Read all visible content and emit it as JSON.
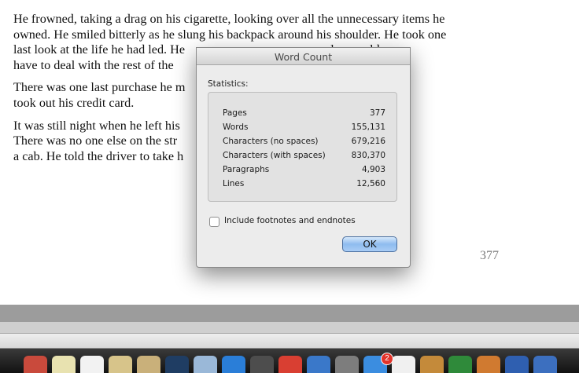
{
  "document": {
    "paragraphs": [
      [
        "He frowned, taking a drag on his cigarette, looking over all the unnecessary items he",
        "owned. He smiled bitterly as he slung his backpack around his shoulder. He took one",
        "last look at the life he had led. He                                            else would",
        "have to deal with the rest of the "
      ],
      [
        "There was one last purchase he m                                             sive laptop and",
        "took out his credit card."
      ],
      [
        "It was still night when he left his                                            few hours.",
        "There was no one else on the str                                             until he found",
        "a cab. He told the driver to take h"
      ]
    ],
    "page_number": "377"
  },
  "dialog": {
    "title": "Word Count",
    "statistics_label": "Statistics:",
    "stats": [
      {
        "label": "Pages",
        "value": "377"
      },
      {
        "label": "Words",
        "value": "155,131"
      },
      {
        "label": "Characters (no spaces)",
        "value": "679,216"
      },
      {
        "label": "Characters (with spaces)",
        "value": "830,370"
      },
      {
        "label": "Paragraphs",
        "value": "4,903"
      },
      {
        "label": "Lines",
        "value": "12,560"
      }
    ],
    "footnotes_checkbox_label": "Include footnotes and endnotes",
    "footnotes_checked": false,
    "ok_label": "OK"
  },
  "dock": {
    "badge_count": "2",
    "items": [
      {
        "icon": "calendar-icon",
        "color": "#c94a3c"
      },
      {
        "icon": "notes-icon",
        "color": "#e8e2b0"
      },
      {
        "icon": "reminders-icon",
        "color": "#f2f2f2"
      },
      {
        "icon": "stickies-icon",
        "color": "#d7c48a"
      },
      {
        "icon": "finder-icon",
        "color": "#c9b07a"
      },
      {
        "icon": "quicktime-icon",
        "color": "#1f3d63"
      },
      {
        "icon": "preview-icon",
        "color": "#9ab8d8"
      },
      {
        "icon": "xcode-icon",
        "color": "#2a7ed8"
      },
      {
        "icon": "mail-icon",
        "color": "#4d4d4d"
      },
      {
        "icon": "chrome-icon",
        "color": "#d93f32"
      },
      {
        "icon": "screen-sharing-icon",
        "color": "#3a78c9"
      },
      {
        "icon": "system-preferences-icon",
        "color": "#7d7d7d"
      },
      {
        "icon": "app-store-icon",
        "color": "#3b8de0"
      },
      {
        "icon": "textedit-icon",
        "color": "#f0f0f0"
      },
      {
        "icon": "script-editor-icon",
        "color": "#c48a3a"
      },
      {
        "icon": "excel-icon",
        "color": "#2f8a3a"
      },
      {
        "icon": "powerpoint-icon",
        "color": "#d07a30"
      },
      {
        "icon": "word-icon",
        "color": "#2f5fb0"
      },
      {
        "icon": "more-icon",
        "color": "#3c6fbf"
      }
    ]
  }
}
